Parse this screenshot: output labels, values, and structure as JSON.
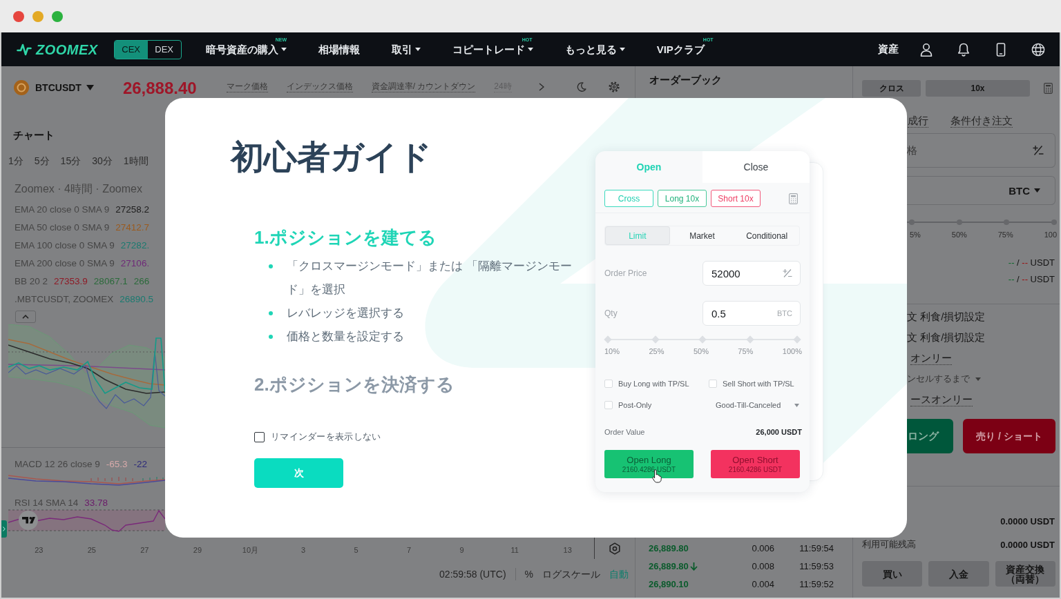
{
  "nav": {
    "logo": "ZOOMEX",
    "exchanges": [
      {
        "label": "CEX",
        "selected": true
      },
      {
        "label": "DEX",
        "selected": false
      }
    ],
    "menu": [
      {
        "label": "暗号資産の購入",
        "dropdown": true,
        "badge": "NEW"
      },
      {
        "label": "相場情報",
        "dropdown": false
      },
      {
        "label": "取引",
        "dropdown": true
      },
      {
        "label": "コピートレード",
        "dropdown": true,
        "badge": "HOT"
      },
      {
        "label": "もっと見る",
        "dropdown": true
      },
      {
        "label": "VIPクラブ",
        "dropdown": false,
        "badge": "HOT"
      }
    ],
    "assets": "資産"
  },
  "ticker": {
    "symbol": "BTCUSDT",
    "price": "26,888.40",
    "stats": [
      "マーク価格",
      "インデックス価格",
      "資金調達率/ カウントダウン",
      "24時"
    ]
  },
  "chart": {
    "title": "チャート",
    "intervals": [
      {
        "label": "1分",
        "selected": false
      },
      {
        "label": "5分",
        "selected": false
      },
      {
        "label": "15分",
        "selected": false
      },
      {
        "label": "30分",
        "selected": false
      },
      {
        "label": "1時間",
        "selected": false
      }
    ],
    "legend_title": "Zoomex · 4時間 · Zoomex",
    "studies": [
      {
        "label": "EMA 20 close 0 SMA 9",
        "values": [
          {
            "text": "27258.2",
            "color": "#1c1c1c"
          }
        ]
      },
      {
        "label": "EMA 50 close 0 SMA 9",
        "values": [
          {
            "text": "27412.7",
            "color": "#9a5a1e"
          }
        ]
      },
      {
        "label": "EMA 100 close 0 SMA 9",
        "values": [
          {
            "text": "27282.",
            "color": "#1a7a70"
          }
        ]
      },
      {
        "label": "EMA 200 close 0 SMA 9",
        "values": [
          {
            "text": "27106.",
            "color": "#6e2a78"
          }
        ]
      },
      {
        "label": "BB 20 2",
        "values": [
          {
            "text": "27353.9",
            "color": "#8e1a26"
          },
          {
            "text": "28067.1",
            "color": "#2a6a3a"
          },
          {
            "text": "266",
            "color": "#2a6a3a"
          }
        ]
      },
      {
        "label": ".MBTCUSDT, ZOOMEX",
        "values": [
          {
            "text": "26890.5",
            "color": "#1a7a70"
          }
        ]
      }
    ],
    "macd": {
      "label": "MACD 12 26 close 9",
      "values": [
        {
          "text": "-65.3",
          "color": "#d8aaaa"
        },
        {
          "text": "-22",
          "color": "#2c2a7a"
        }
      ]
    },
    "rsi": {
      "label": "RSI 14 SMA 14",
      "values": [
        {
          "text": "33.78",
          "color": "#6a1a6a"
        }
      ]
    },
    "x_labels": [
      "23",
      "25",
      "27",
      "29",
      "10月",
      "3",
      "5",
      "7",
      "9",
      "11",
      "13"
    ],
    "time": "02:59:58 (UTC)",
    "toggles": [
      {
        "label": "%",
        "on": false
      },
      {
        "label": "ログスケール",
        "on": false
      },
      {
        "label": "自動",
        "on": true
      }
    ]
  },
  "order_book": {
    "title": "オーダーブック",
    "trades": [
      {
        "price": "26,889.80",
        "down": false,
        "qty": "0.006",
        "time": "11:59:54"
      },
      {
        "price": "26,889.80",
        "down": true,
        "qty": "0.008",
        "time": "11:59:53"
      },
      {
        "price": "26,890.10",
        "down": false,
        "qty": "0.004",
        "time": "11:59:52"
      }
    ]
  },
  "order_panel": {
    "margin_buttons": [
      "クロス",
      "10x"
    ],
    "order_types": [
      {
        "label": "成行",
        "selected": false
      },
      {
        "label": "条件付き注文",
        "selected": false
      }
    ],
    "price_field": {
      "placeholder": "格"
    },
    "qty_field": {
      "unit": "BTC"
    },
    "slider_labels": [
      "5%",
      "50%",
      "75%",
      "100"
    ],
    "costs": [
      {
        "long": "--",
        "separator": "/",
        "short": "--",
        "unit": "USDT"
      },
      {
        "long": "--",
        "separator": "/",
        "short": "--",
        "unit": "USDT"
      }
    ],
    "options": [
      {
        "kind": "text",
        "text": "文 利食/損切設定"
      },
      {
        "kind": "text",
        "text": "文 利食/損切設定"
      },
      {
        "kind": "underlined",
        "text": "オンリー"
      },
      {
        "kind": "dropdown",
        "text": "ンセルするまで"
      },
      {
        "kind": "underlined",
        "text": "ースオンリー"
      }
    ],
    "actions": [
      {
        "kind": "buy",
        "label": "ロング"
      },
      {
        "kind": "sell",
        "label": "売り / ショート"
      }
    ],
    "balances": [
      {
        "value": "0.0000 USDT"
      },
      {
        "label": "利用可能残高",
        "value": "0.0000 USDT"
      }
    ],
    "footer_buttons": [
      "買い",
      "入金",
      "資産交換（両替）"
    ]
  },
  "guide": {
    "title": "初心者ガイド",
    "steps": [
      {
        "title": "1.ポジションを建てる",
        "active": true,
        "bullets": [
          "「クロスマージンモード」または 「隔離マージンモード」を選択",
          "レバレッジを選択する",
          "価格と数量を設定する"
        ]
      },
      {
        "title": "2.ポジションを決済する",
        "active": false
      }
    ],
    "dont_remind": {
      "label": "リマインダーを表示しない",
      "checked": false
    },
    "next_button": "次",
    "preview": {
      "tabs": [
        {
          "label": "Open",
          "selected": true
        },
        {
          "label": "Close",
          "selected": false
        }
      ],
      "modes": [
        {
          "kind": "margin",
          "label": "Cross"
        },
        {
          "kind": "long",
          "label": "Long 10x"
        },
        {
          "kind": "short",
          "label": "Short 10x"
        }
      ],
      "order_types": [
        {
          "label": "Limit",
          "selected": true
        },
        {
          "label": "Market",
          "selected": false
        },
        {
          "label": "Conditional",
          "selected": false
        }
      ],
      "fields": [
        {
          "kind": "price",
          "label": "Order Price",
          "value": "52000"
        },
        {
          "kind": "qty",
          "label": "Qty",
          "value": "0.5",
          "unit": "BTC"
        }
      ],
      "slider_marks": [
        "10%",
        "25%",
        "50%",
        "75%",
        "100%"
      ],
      "options": [
        {
          "label": "Buy Long with TP/SL",
          "checked": false
        },
        {
          "label": "Sell Short with TP/SL",
          "checked": false
        },
        {
          "label": "Post-Only",
          "checked": false
        }
      ],
      "time_in_force": "Good-Till-Canceled",
      "order_value": {
        "label": "Order Value",
        "value": "26,000 USDT"
      },
      "actions": [
        {
          "kind": "long",
          "label": "Open Long",
          "cost": "2160.4286 USDT"
        },
        {
          "kind": "short",
          "label": "Open Short",
          "cost": "2160.4286 USDT"
        }
      ]
    }
  }
}
